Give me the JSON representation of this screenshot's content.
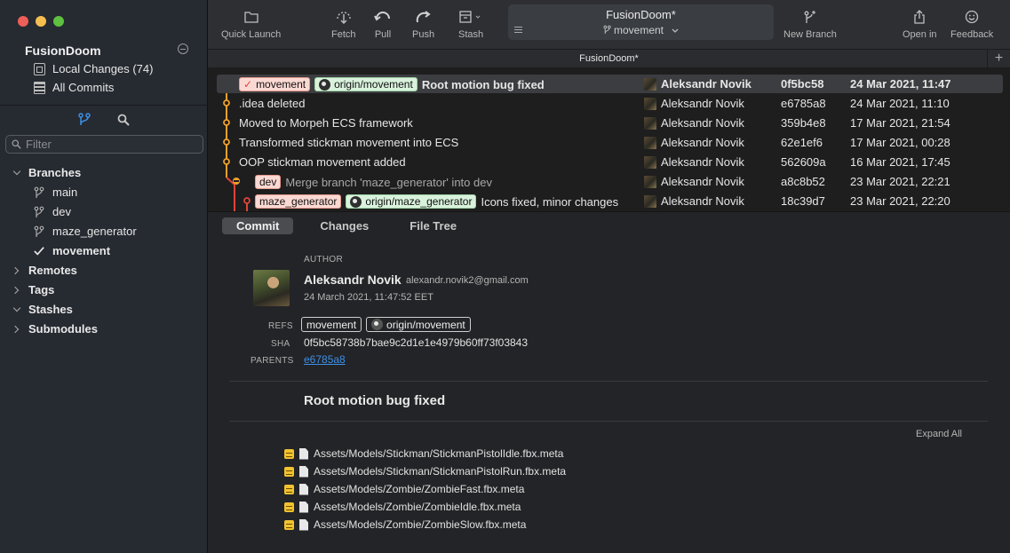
{
  "sidebar": {
    "repo_name": "FusionDoom",
    "local_changes": "Local Changes (74)",
    "all_commits": "All Commits",
    "filter_placeholder": "Filter",
    "sections": {
      "branches": "Branches",
      "remotes": "Remotes",
      "tags": "Tags",
      "stashes": "Stashes",
      "submodules": "Submodules"
    },
    "branches": [
      "main",
      "dev",
      "maze_generator",
      "movement"
    ]
  },
  "toolbar": {
    "quick_launch": "Quick Launch",
    "fetch": "Fetch",
    "pull": "Pull",
    "push": "Push",
    "stash": "Stash",
    "title": "FusionDoom*",
    "branch": "movement",
    "new_branch": "New Branch",
    "open_in": "Open in",
    "feedback": "Feedback"
  },
  "tab": {
    "title": "FusionDoom*",
    "plus": "+"
  },
  "commits": [
    {
      "refs_local": "movement",
      "refs_remote": "origin/movement",
      "message": "Root motion bug fixed",
      "author": "Aleksandr Novik",
      "sha": "0f5bc58",
      "date": "24 Mar 2021, 11:47"
    },
    {
      "message": ".idea deleted",
      "author": "Aleksandr Novik",
      "sha": "e6785a8",
      "date": "24 Mar 2021, 11:10"
    },
    {
      "message": "Moved to Morpeh ECS framework",
      "author": "Aleksandr Novik",
      "sha": "359b4e8",
      "date": "17 Mar 2021, 21:54"
    },
    {
      "message": "Transformed stickman movement into ECS",
      "author": "Aleksandr Novik",
      "sha": "62e1ef6",
      "date": "17 Mar 2021, 00:28"
    },
    {
      "message": "OOP stickman movement added",
      "author": "Aleksandr Novik",
      "sha": "562609a",
      "date": "16 Mar 2021, 17:45"
    },
    {
      "refs_local": "dev",
      "message": "Merge branch 'maze_generator' into dev",
      "author": "Aleksandr Novik",
      "sha": "a8c8b52",
      "date": "23 Mar 2021, 22:21"
    },
    {
      "refs_local": "maze_generator",
      "refs_remote": "origin/maze_generator",
      "message": "Icons fixed, minor changes",
      "author": "Aleksandr Novik",
      "sha": "18c39d7",
      "date": "23 Mar 2021, 22:20"
    }
  ],
  "detail": {
    "tabs": [
      "Commit",
      "Changes",
      "File Tree"
    ],
    "author_label": "AUTHOR",
    "author_name": "Aleksandr Novik",
    "author_email": "alexandr.novik2@gmail.com",
    "author_date": "24 March 2021, 11:47:52 EET",
    "refs_label": "REFS",
    "refs": [
      "movement",
      "origin/movement"
    ],
    "sha_label": "SHA",
    "sha": "0f5bc58738b7bae9c2d1e1e4979b60ff73f03843",
    "parents_label": "PARENTS",
    "parent": "e6785a8",
    "subject": "Root motion bug fixed",
    "expand_all": "Expand All",
    "files": [
      "Assets/Models/Stickman/StickmanPistolIdle.fbx.meta",
      "Assets/Models/Stickman/StickmanPistolRun.fbx.meta",
      "Assets/Models/Zombie/ZombieFast.fbx.meta",
      "Assets/Models/Zombie/ZombieIdle.fbx.meta",
      "Assets/Models/Zombie/ZombieSlow.fbx.meta"
    ]
  },
  "colors": {
    "accent": "#3d8fe5",
    "graph_orange": "#f0a02c",
    "graph_red": "#e0443a",
    "ref_local_bg": "#fbd9d3",
    "ref_remote_bg": "#d9f2dc",
    "modified": "#f2c230"
  },
  "icons": [
    "doc-icon",
    "list-icon",
    "branch-icon",
    "search-icon",
    "checkmark-icon",
    "github-icon",
    "file-icon",
    "modified-icon"
  ]
}
